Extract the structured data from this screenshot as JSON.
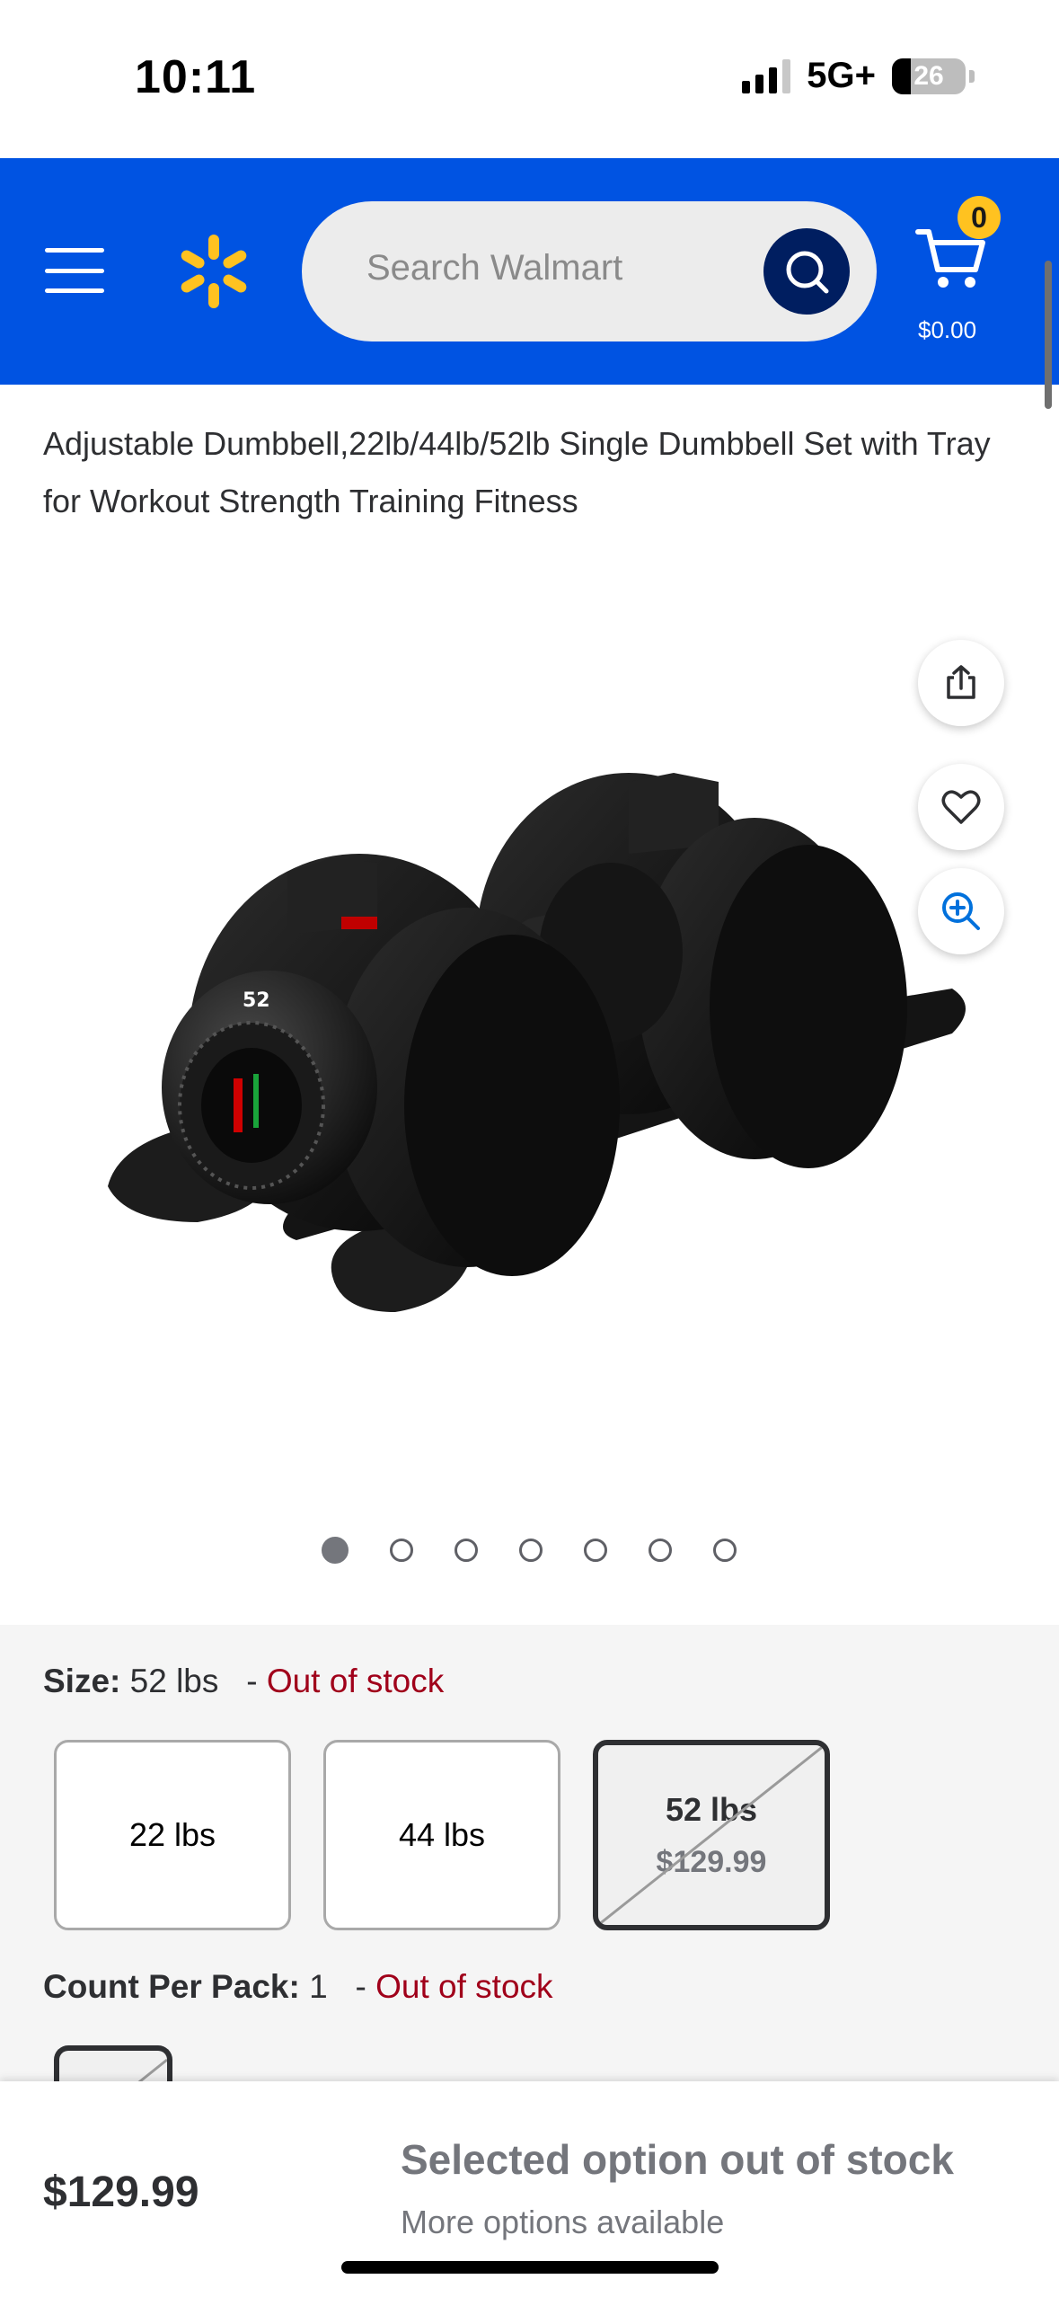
{
  "status_bar": {
    "time": "10:11",
    "network": "5G+",
    "battery": "26"
  },
  "header": {
    "search_placeholder": "Search Walmart",
    "cart_count": "0",
    "cart_total": "$0.00",
    "brand_color": "#0053e2",
    "spark_color": "#ffc220"
  },
  "product": {
    "title": "Adjustable Dumbbell,22lb/44lb/52lb Single Dumbbell Set with Tray for Workout Strength Training Fitness",
    "dial_number": "52",
    "image_count": 7,
    "active_image": 1
  },
  "variants": {
    "size": {
      "label": "Size:",
      "value": "52 lbs",
      "separator": "-",
      "status": "Out of stock",
      "options": [
        {
          "label": "22 lbs"
        },
        {
          "label": "44 lbs"
        },
        {
          "label": "52 lbs",
          "price": "$129.99",
          "selected": true,
          "unavailable": true
        }
      ]
    },
    "count_per_pack": {
      "label": "Count Per Pack:",
      "value": "1",
      "separator": "-",
      "status": "Out of stock"
    }
  },
  "bottom_bar": {
    "price": "$129.99",
    "oos_title": "Selected option out of stock",
    "oos_subtitle": "More options available"
  },
  "icons": [
    "menu-icon",
    "walmart-spark-icon",
    "search-icon",
    "cart-icon",
    "share-icon",
    "heart-icon",
    "zoom-icon"
  ]
}
